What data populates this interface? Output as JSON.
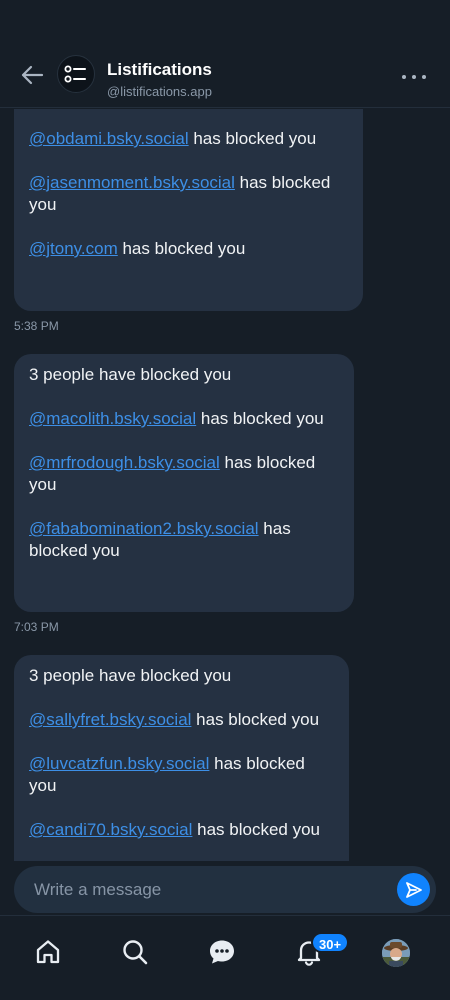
{
  "header": {
    "channel_name": "Listifications",
    "channel_handle": "@listifications.app"
  },
  "messages": {
    "partial": {
      "lines": [
        {
          "mention": "@obdami.bsky.social",
          "text": " has blocked you"
        },
        {
          "mention": "@jasenmoment.bsky.social",
          "text": " has blocked you"
        },
        {
          "mention": "@jtony.com",
          "text": " has blocked you"
        }
      ]
    },
    "time_1": "5:38 PM",
    "msg_2": {
      "intro": "3 people have blocked you",
      "lines": [
        {
          "mention": "@macolith.bsky.social",
          "text": " has blocked you"
        },
        {
          "mention": "@mrfrodough.bsky.social",
          "text": " has blocked you"
        },
        {
          "mention": "@fababomination2.bsky.social",
          "text": " has blocked you"
        }
      ]
    },
    "time_2": "7:03 PM",
    "msg_3": {
      "intro": "3 people have blocked you",
      "lines": [
        {
          "mention": "@sallyfret.bsky.social",
          "text": " has blocked you"
        },
        {
          "mention": "@luvcatzfun.bsky.social",
          "text": " has blocked you"
        },
        {
          "mention": "@candi70.bsky.social",
          "text": " has blocked you"
        }
      ]
    }
  },
  "composer": {
    "placeholder": "Write a message"
  },
  "nav": {
    "notifications_badge": "30+"
  },
  "colors": {
    "background": "#161e27",
    "bubble": "#253142",
    "link": "#3d8fe6",
    "accent": "#1083fe"
  },
  "icons": [
    "back-arrow-icon",
    "list-icon",
    "more-icon",
    "send-icon",
    "home-icon",
    "search-icon",
    "chat-icon",
    "bell-icon"
  ]
}
